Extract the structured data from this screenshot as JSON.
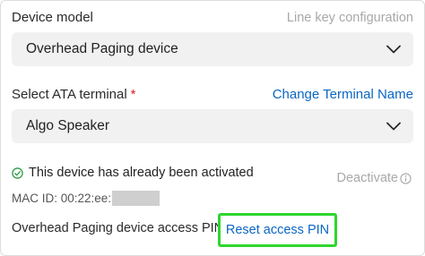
{
  "device_model": {
    "label": "Device model",
    "line_key_link": "Line key configuration",
    "selected": "Overhead Paging device"
  },
  "ata_terminal": {
    "label": "Select ATA terminal",
    "required_mark": "*",
    "change_link": "Change Terminal Name",
    "selected": "Algo Speaker"
  },
  "activation": {
    "status_text": "This device has already been activated",
    "deactivate_label": "Deactivate",
    "mac_label": "MAC ID: 00:22:ee:"
  },
  "pin": {
    "label": "Overhead Paging device access PIN",
    "reset_link": "Reset access PIN"
  },
  "colors": {
    "link": "#0b66c2",
    "success": "#2e9e44",
    "highlight": "#2fd62f",
    "required": "#d31f1f"
  }
}
